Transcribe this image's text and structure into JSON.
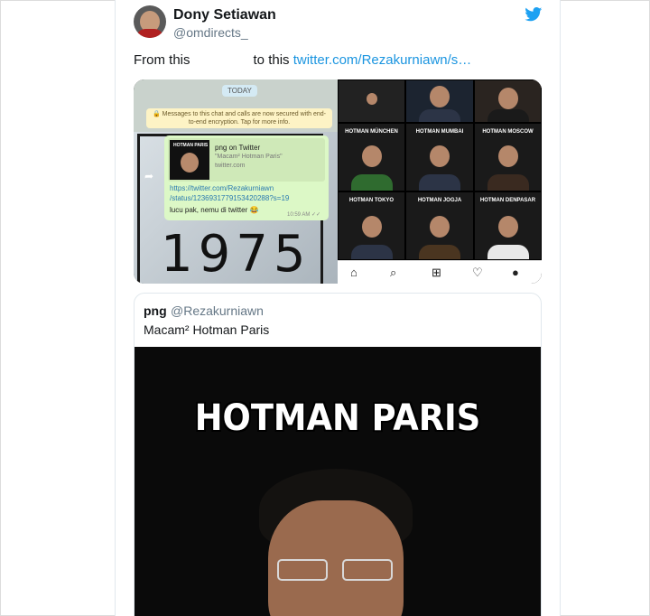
{
  "tweet": {
    "author_name": "Dony Setiawan",
    "author_handle": "@omdirects_",
    "text_before": "From this",
    "text_middle": "to this",
    "link": "twitter.com/Rezakurniawn/s…",
    "bird_icon": "twitter-bird-icon",
    "accent": "#1da1f2"
  },
  "whatsapp": {
    "today_label": "TODAY",
    "encryption_notice": "Messages to this chat and calls are now secured with end-to-end encryption. Tap for more info.",
    "preview_thumb_label": "HOTMAN PARIS",
    "preview_title": "png on Twitter",
    "preview_desc": "\"Macam² Hotman Paris\"",
    "preview_url": "twitter.com",
    "link_line1": "https://twitter.com/Rezakurniawn",
    "link_line2": "/status/1236931779153420288?s=19",
    "message": "lucu pak, nemu di twitter 😂",
    "time": "10:59 AM ✓✓",
    "background_year": "1975",
    "bubble_color": "#dcf8c6"
  },
  "instagram": {
    "tiles": [
      {
        "label": "HOTMAN MÜNCHEN"
      },
      {
        "label": "HOTMAN MUMBAI"
      },
      {
        "label": "HOTMAN MOSCOW"
      },
      {
        "label": "HOTMAN TOKYO"
      },
      {
        "label": "HOTMAN JOGJA"
      },
      {
        "label": "HOTMAN DENPASAR"
      }
    ],
    "nav_icons": [
      "home-icon",
      "search-icon",
      "add-post-icon",
      "heart-icon",
      "profile-icon"
    ]
  },
  "quoted": {
    "name": "png",
    "handle": "@Rezakurniawn",
    "text": "Macam² Hotman Paris",
    "meme_title": "HOTMAN PARIS"
  }
}
